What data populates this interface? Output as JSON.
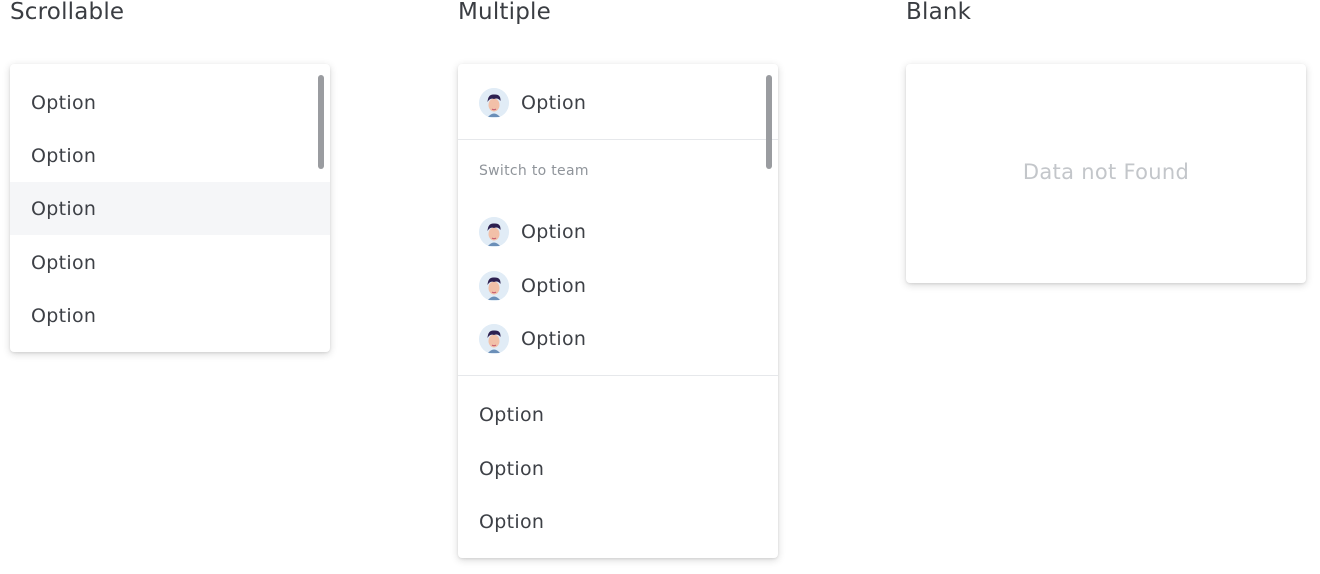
{
  "sections": {
    "scrollable": {
      "title": "Scrollable"
    },
    "multiple": {
      "title": "Multiple"
    },
    "blank": {
      "title": "Blank"
    }
  },
  "scrollable_list": {
    "options": [
      "Option",
      "Option",
      "Option",
      "Option",
      "Option"
    ],
    "highlighted_index": 2
  },
  "multiple_list": {
    "current": {
      "label": "Option",
      "icon": "user-avatar-icon"
    },
    "group_label": "Switch to team",
    "team_options": [
      {
        "label": "Option",
        "icon": "user-avatar-icon"
      },
      {
        "label": "Option",
        "icon": "user-avatar-icon"
      },
      {
        "label": "Option",
        "icon": "user-avatar-icon"
      }
    ],
    "plain_options": [
      "Option",
      "Option",
      "Option"
    ]
  },
  "blank_list": {
    "empty_message": "Data not Found"
  },
  "colors": {
    "hover_background": "#f5f6f8",
    "scrollbar": "#9a9ca0",
    "empty_text": "#c3c6ca",
    "avatar_background": "#e1ecf6"
  }
}
